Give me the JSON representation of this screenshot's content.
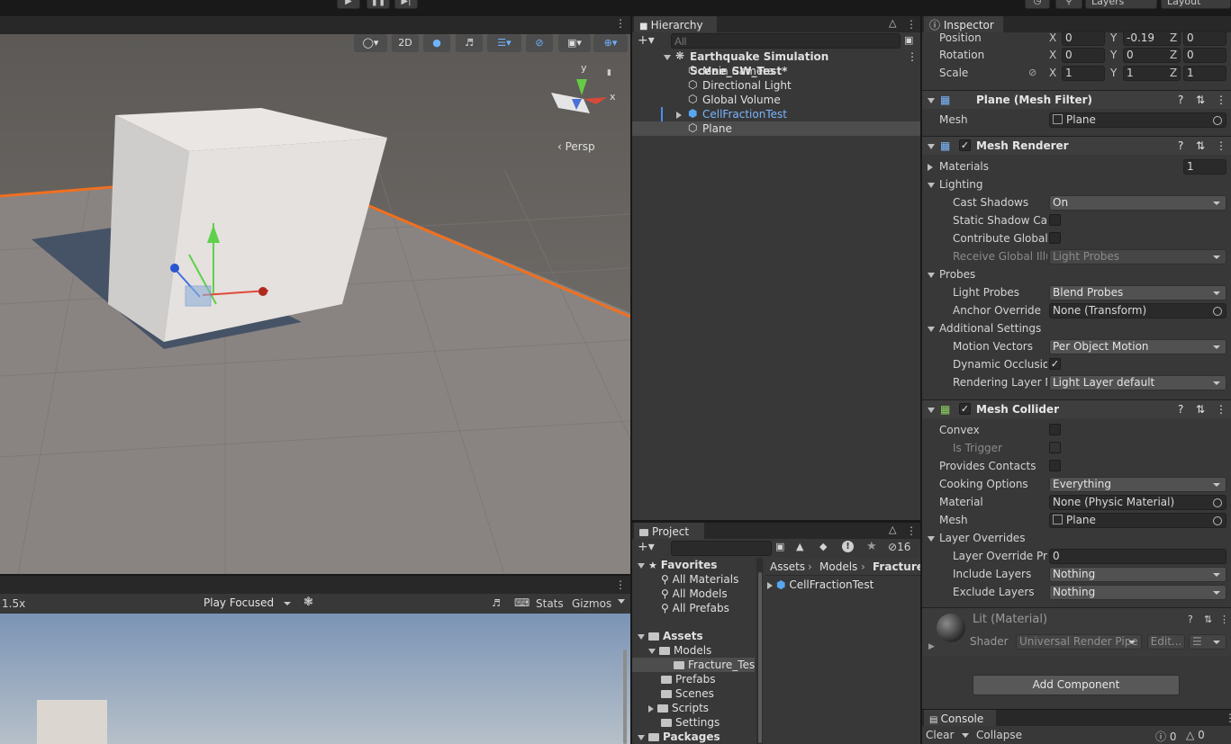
{
  "toolbar": {
    "layers_label": "Layers",
    "layout_label": "Layout"
  },
  "scene": {
    "btn_2d": "2D",
    "persp_label": "‹ Persp",
    "gizmo_x": "x",
    "gizmo_y": "y"
  },
  "game": {
    "scale_label": "1.5x",
    "play_mode": "Play Focused",
    "stats_label": "Stats",
    "gizmos_label": "Gizmos"
  },
  "hierarchy": {
    "tab": "Hierarchy",
    "search_placeholder": "All",
    "scene_name": "Earthquake Simulation Scene_SW_Test*",
    "items": [
      {
        "label": "Main Camera"
      },
      {
        "label": "Directional Light"
      },
      {
        "label": "Global Volume"
      },
      {
        "label": "CellFractionTest"
      },
      {
        "label": "Plane"
      }
    ]
  },
  "project": {
    "tab": "Project",
    "hidden_count": "16",
    "breadcrumb": [
      "Assets",
      "Models",
      "Fracture_"
    ],
    "favorites_label": "Favorites",
    "favorites": [
      "All Materials",
      "All Models",
      "All Prefabs"
    ],
    "assets_label": "Assets",
    "assets": {
      "models": "Models",
      "fracture": "Fracture_Tes",
      "prefabs": "Prefabs",
      "scenes": "Scenes",
      "scripts": "Scripts",
      "settings": "Settings"
    },
    "packages_label": "Packages",
    "file": "CellFractionTest"
  },
  "inspector": {
    "tab": "Inspector",
    "transform": {
      "position": {
        "label": "Position",
        "x": "0",
        "y": "-0.19",
        "z": "0"
      },
      "rotation": {
        "label": "Rotation",
        "x": "0",
        "y": "0",
        "z": "0"
      },
      "scale": {
        "label": "Scale",
        "x": "1",
        "y": "1",
        "z": "1"
      }
    },
    "mesh_filter": {
      "title": "Plane (Mesh Filter)",
      "mesh_label": "Mesh",
      "mesh_value": "Plane"
    },
    "mesh_renderer": {
      "title": "Mesh Renderer",
      "materials_label": "Materials",
      "materials_count": "1",
      "lighting_label": "Lighting",
      "cast_shadows_label": "Cast Shadows",
      "cast_shadows_value": "On",
      "static_shadow_label": "Static Shadow Cas",
      "contribute_gi_label": "Contribute Global I",
      "receive_gi_label": "Receive Global Illu",
      "receive_gi_value": "Light Probes",
      "probes_label": "Probes",
      "light_probes_label": "Light Probes",
      "light_probes_value": "Blend Probes",
      "anchor_label": "Anchor Override",
      "anchor_value": "None (Transform)",
      "additional_label": "Additional Settings",
      "motion_label": "Motion Vectors",
      "motion_value": "Per Object Motion",
      "dynamic_occ_label": "Dynamic Occlusion",
      "rendering_layer_label": "Rendering Layer M",
      "rendering_layer_value": "Light Layer default"
    },
    "mesh_collider": {
      "title": "Mesh Collider",
      "convex_label": "Convex",
      "trigger_label": "Is Trigger",
      "contacts_label": "Provides Contacts",
      "cooking_label": "Cooking Options",
      "cooking_value": "Everything",
      "material_label": "Material",
      "material_value": "None (Physic Material)",
      "mesh_label": "Mesh",
      "mesh_value": "Plane",
      "overrides_label": "Layer Overrides",
      "priority_label": "Layer Override Pric",
      "priority_value": "0",
      "include_label": "Include Layers",
      "include_value": "Nothing",
      "exclude_label": "Exclude Layers",
      "exclude_value": "Nothing"
    },
    "material": {
      "title": "Lit (Material)",
      "shader_label": "Shader",
      "shader_value": "Universal Render Pipe",
      "edit_label": "Edit..."
    },
    "add_component": "Add Component"
  },
  "console": {
    "tab": "Console",
    "clear": "Clear",
    "collapse": "Collapse",
    "errors": "0",
    "warnings": "0"
  }
}
